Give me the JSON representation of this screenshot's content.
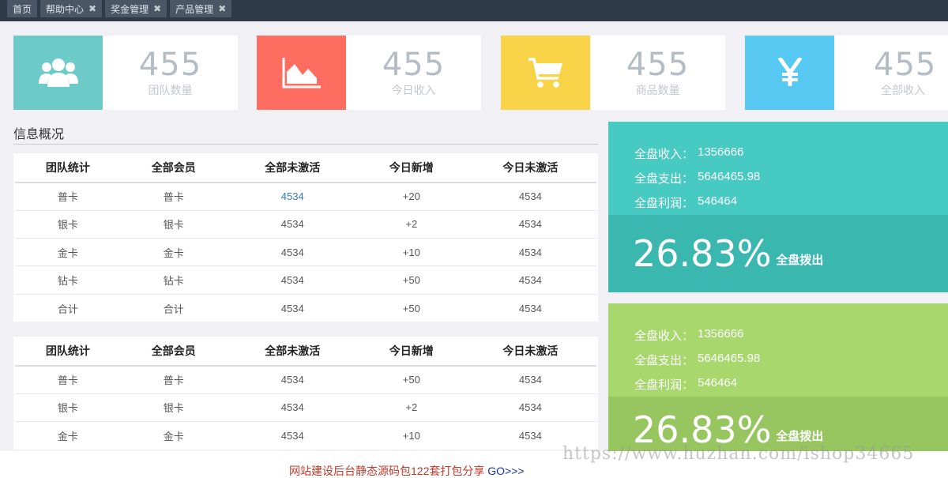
{
  "tabs": [
    {
      "label": "首页",
      "closable": false
    },
    {
      "label": "帮助中心",
      "closable": true
    },
    {
      "label": "奖金管理",
      "closable": true
    },
    {
      "label": "产品管理",
      "closable": true
    }
  ],
  "tab_close_glyph": "✖",
  "stat_cards": [
    {
      "value": "455",
      "label": "团队数量",
      "icon": "users-icon",
      "color": "#6ccac9"
    },
    {
      "value": "455",
      "label": "今日收入",
      "icon": "area-chart-icon",
      "color": "#ff6c60"
    },
    {
      "value": "455",
      "label": "商品数量",
      "icon": "cart-icon",
      "color": "#f8d347"
    },
    {
      "value": "455",
      "label": "全部收入",
      "icon": "yen-icon",
      "color": "#57c8f2"
    }
  ],
  "section_title": "信息概况",
  "table1": {
    "headers": [
      "团队统计",
      "全部会员",
      "全部未激活",
      "今日新增",
      "今日未激活"
    ],
    "rows": [
      [
        "普卡",
        "普卡",
        "4534",
        "+20",
        "4534"
      ],
      [
        "银卡",
        "银卡",
        "4534",
        "+2",
        "4534"
      ],
      [
        "金卡",
        "金卡",
        "4534",
        "+10",
        "4534"
      ],
      [
        "钻卡",
        "钻卡",
        "4534",
        "+50",
        "4534"
      ],
      [
        "合计",
        "合计",
        "4534",
        "+50",
        "4534"
      ]
    ]
  },
  "table2": {
    "headers": [
      "团队统计",
      "全部会员",
      "全部未激活",
      "今日新增",
      "今日未激活"
    ],
    "rows": [
      [
        "普卡",
        "普卡",
        "4534",
        "+50",
        "4534"
      ],
      [
        "银卡",
        "银卡",
        "4534",
        "+2",
        "4534"
      ],
      [
        "金卡",
        "金卡",
        "4534",
        "+10",
        "4534"
      ]
    ]
  },
  "panels": [
    {
      "rows": [
        {
          "k": "全盘收入：",
          "v": "1356666"
        },
        {
          "k": "全盘支出：",
          "v": "5646465.98"
        },
        {
          "k": "全盘利润：",
          "v": "546464"
        }
      ],
      "pct": "26.83%",
      "pct_label": "全盘拨出",
      "color_top": "#47cac1",
      "color_bottom": "#3ab7ae"
    },
    {
      "rows": [
        {
          "k": "全盘收入：",
          "v": "1356666"
        },
        {
          "k": "全盘支出：",
          "v": "5646465.98"
        },
        {
          "k": "全盘利润：",
          "v": "546464"
        }
      ],
      "pct": "26.83%",
      "pct_label": "全盘拨出",
      "color_top": "#a8d76e",
      "color_bottom": "#97c660"
    }
  ],
  "footer": {
    "ad_text": "网站建设后台静态源码包122套打包分享",
    "go_text": "GO>>>"
  },
  "watermark": "https://www.huzhan.com/ishop34665"
}
